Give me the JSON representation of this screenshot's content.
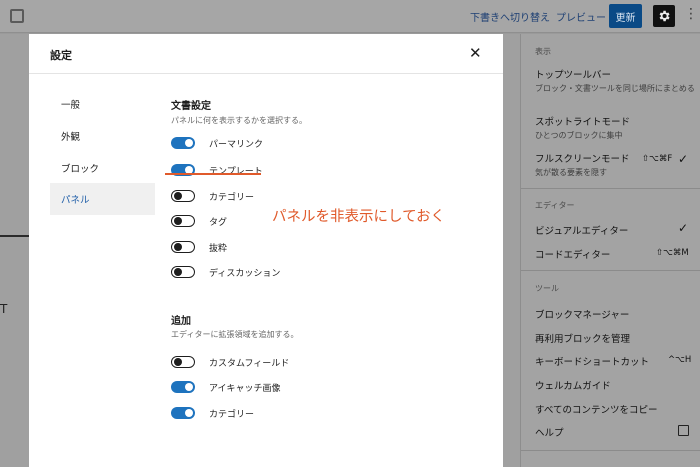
{
  "topbar": {
    "draft_label": "下書きへ切り替え",
    "preview_label": "プレビュー",
    "update_label": "更新",
    "settings_icon": "gear-icon",
    "more_icon": "kebab-icon"
  },
  "canvas": {
    "letter": "T"
  },
  "menu": {
    "view": {
      "heading": "表示",
      "items": [
        {
          "label": "トップツールバー",
          "sub": "ブロック・文書ツールを同じ場所にまとめる"
        },
        {
          "label": "スポットライトモード",
          "sub": "ひとつのブロックに集中"
        },
        {
          "label": "フルスクリーンモード",
          "sub": "気が散る要素を隠す",
          "shortcut": "⇧⌥⌘F",
          "checked": true
        }
      ]
    },
    "editor": {
      "heading": "エディター",
      "items": [
        {
          "label": "ビジュアルエディター",
          "checked": true
        },
        {
          "label": "コードエディター",
          "shortcut": "⇧⌥⌘M"
        }
      ]
    },
    "tools": {
      "heading": "ツール",
      "items": [
        {
          "label": "ブロックマネージャー"
        },
        {
          "label": "再利用ブロックを管理"
        },
        {
          "label": "キーボードショートカット",
          "shortcut": "^⌥H"
        },
        {
          "label": "ウェルカムガイド"
        },
        {
          "label": "すべてのコンテンツをコピー"
        },
        {
          "label": "ヘルプ"
        }
      ]
    }
  },
  "modal": {
    "title": "設定",
    "close_icon": "close-icon",
    "nav": [
      {
        "label": "一般",
        "active": false
      },
      {
        "label": "外観",
        "active": false
      },
      {
        "label": "ブロック",
        "active": false
      },
      {
        "label": "パネル",
        "active": true
      }
    ],
    "doc_settings": {
      "title": "文書設定",
      "desc": "パネルに何を表示するかを選択する。",
      "options": [
        {
          "label": "パーマリンク",
          "on": true
        },
        {
          "label": "テンプレート",
          "on": true
        },
        {
          "label": "カテゴリー",
          "on": false
        },
        {
          "label": "タグ",
          "on": false
        },
        {
          "label": "抜粋",
          "on": false
        },
        {
          "label": "ディスカッション",
          "on": false
        }
      ]
    },
    "additional": {
      "title": "追加",
      "desc": "エディターに拡張領域を追加する。",
      "options": [
        {
          "label": "カスタムフィールド",
          "on": false
        },
        {
          "label": "アイキャッチ画像",
          "on": true
        },
        {
          "label": "カテゴリー",
          "on": true
        }
      ]
    }
  },
  "annotation": {
    "text": "パネルを非表示にしておく",
    "color": "#e05a2b"
  },
  "colors": {
    "accent": "#1e73be",
    "update_button": "#0a4a86"
  }
}
